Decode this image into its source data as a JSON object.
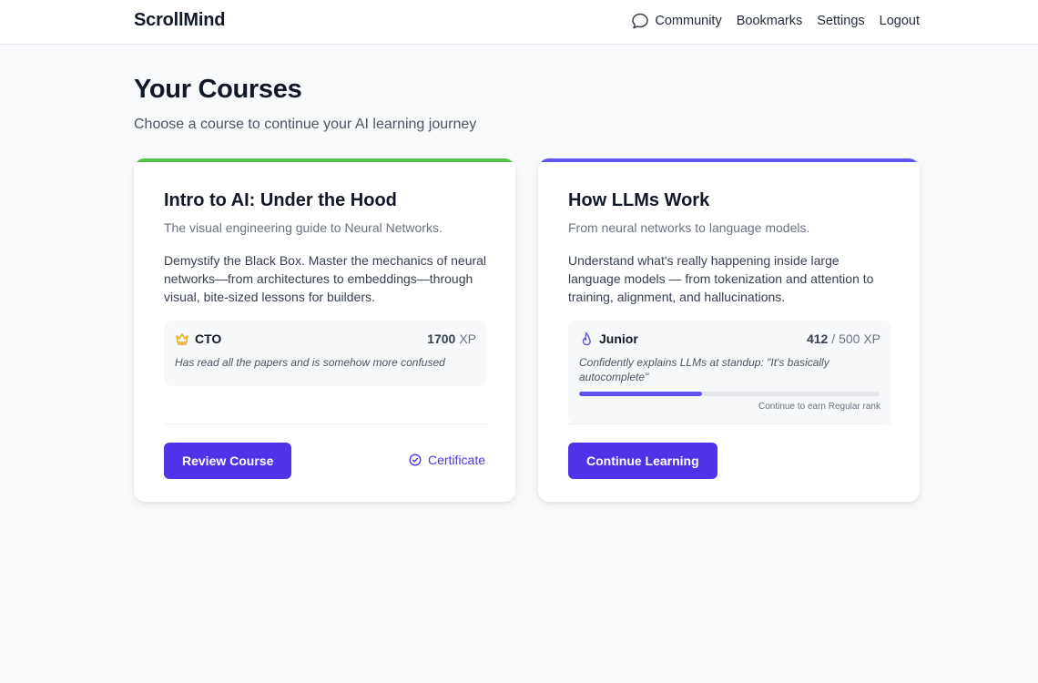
{
  "header": {
    "brand": "ScrollMind",
    "nav": {
      "community": "Community",
      "bookmarks": "Bookmarks",
      "settings": "Settings",
      "logout": "Logout"
    }
  },
  "main": {
    "title": "Your Courses",
    "subtitle": "Choose a course to continue your AI learning journey"
  },
  "courses": [
    {
      "accent_color": "#55c04c",
      "title": "Intro to AI: Under the Hood",
      "tagline": "The visual engineering guide to Neural Networks.",
      "description": "Demystify the Black Box. Master the mechanics of neural networks—from architectures to embeddings—through visual, bite-sized lessons for builders.",
      "rank": {
        "icon": "crown-icon",
        "name": "CTO",
        "xp": "1700",
        "xp_suffix": "XP",
        "quote": "Has read all the papers and is somehow more confused"
      },
      "button_label": "Review Course",
      "certificate_label": "Certificate"
    },
    {
      "accent_color": "#6054f0",
      "title": "How LLMs Work",
      "tagline": "From neural networks to language models.",
      "description": "Understand what's really happening inside large language models — from tokenization and attention to training, alignment, and hallucinations.",
      "rank": {
        "icon": "flame-icon",
        "name": "Junior",
        "xp": "412",
        "xp_suffix": "/ 500 XP",
        "quote": "Confidently explains LLMs at standup: \"It's basically autocomplete\"",
        "progress": 0.41,
        "progress_hint": "Continue to earn Regular rank"
      },
      "button_label": "Continue Learning"
    }
  ],
  "colors": {
    "primary": "#4f33e8",
    "background": "#f8f9fb",
    "crown": "#e6a817"
  }
}
